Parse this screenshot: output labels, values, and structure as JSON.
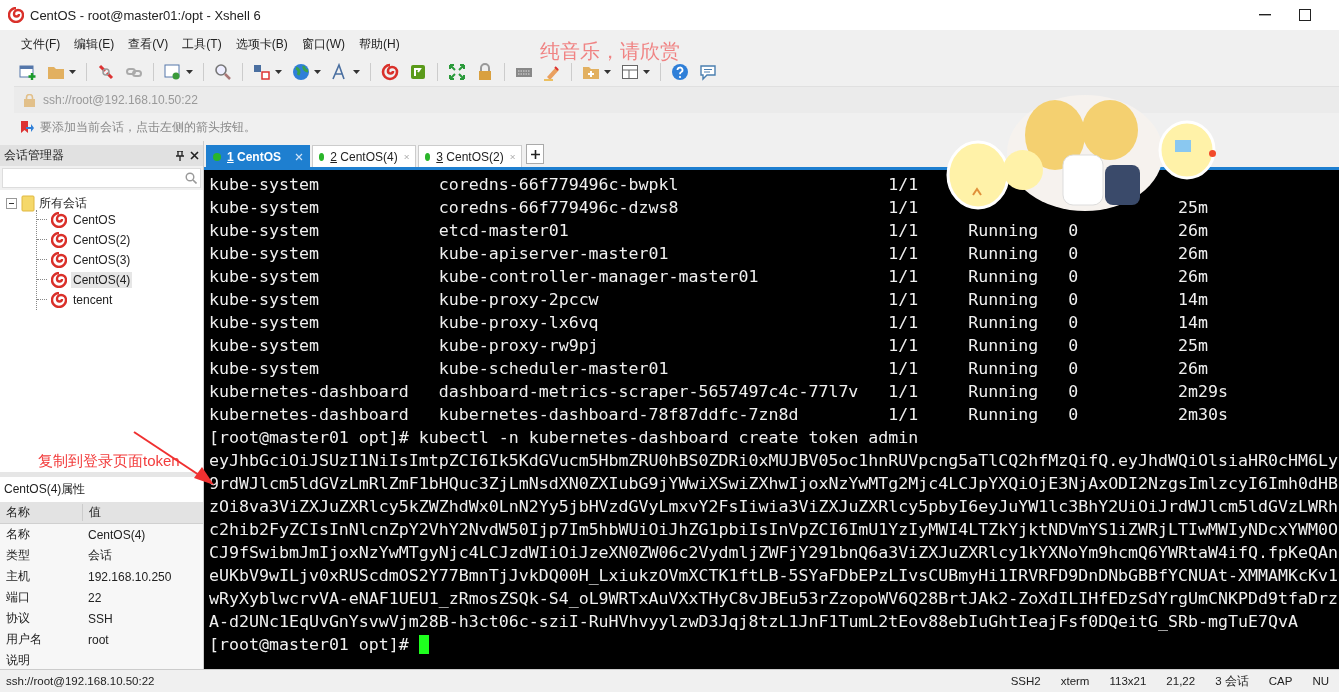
{
  "window": {
    "title": "CentOS - root@master01:/opt - Xshell 6"
  },
  "menu": [
    "文件(F)",
    "编辑(E)",
    "查看(V)",
    "工具(T)",
    "选项卡(B)",
    "窗口(W)",
    "帮助(H)"
  ],
  "overlay_text": "纯音乐，请欣赏",
  "address": {
    "value": "ssh://root@192.168.10.50:22"
  },
  "hint": "要添加当前会话，点击左侧的箭头按钮。",
  "session_manager": {
    "title": "会话管理器",
    "tree": [
      {
        "label": "所有会话",
        "expanded": true,
        "children": [
          {
            "label": "CentOS",
            "selected": false
          },
          {
            "label": "CentOS(2)",
            "selected": false
          },
          {
            "label": "CentOS(3)",
            "selected": false
          },
          {
            "label": "CentOS(4)",
            "selected": true
          },
          {
            "label": "tencent",
            "selected": false
          }
        ]
      }
    ]
  },
  "annotation": "复制到登录页面token",
  "properties": {
    "title": "CentOS(4)属性",
    "columns": [
      "名称",
      "值"
    ],
    "rows": [
      [
        "名称",
        "CentOS(4)"
      ],
      [
        "类型",
        "会话"
      ],
      [
        "主机",
        "192.168.10.250"
      ],
      [
        "端口",
        "22"
      ],
      [
        "协议",
        "SSH"
      ],
      [
        "用户名",
        "root"
      ],
      [
        "说明"
      ]
    ]
  },
  "tabs": [
    {
      "number": "1",
      "label": "CentOS",
      "selected": true
    },
    {
      "number": "2",
      "label": "CentOS(4)",
      "selected": false
    },
    {
      "number": "3",
      "label": "CentOS(2)",
      "selected": false
    }
  ],
  "terminal": {
    "pods": [
      {
        "namespace": "kube-system",
        "name": "coredns-66f779496c-bwpkl",
        "ready": "1/1"
      },
      {
        "namespace": "kube-system",
        "name": "coredns-66f779496c-dzws8",
        "ready": "1/1",
        "age": "25m"
      },
      {
        "namespace": "kube-system",
        "name": "etcd-master01",
        "ready": "1/1",
        "status": "Running",
        "restarts": "0",
        "age": "26m"
      },
      {
        "namespace": "kube-system",
        "name": "kube-apiserver-master01",
        "ready": "1/1",
        "status": "Running",
        "restarts": "0",
        "age": "26m"
      },
      {
        "namespace": "kube-system",
        "name": "kube-controller-manager-master01",
        "ready": "1/1",
        "status": "Running",
        "restarts": "0",
        "age": "26m"
      },
      {
        "namespace": "kube-system",
        "name": "kube-proxy-2pccw",
        "ready": "1/1",
        "status": "Running",
        "restarts": "0",
        "age": "14m"
      },
      {
        "namespace": "kube-system",
        "name": "kube-proxy-lx6vq",
        "ready": "1/1",
        "status": "Running",
        "restarts": "0",
        "age": "14m"
      },
      {
        "namespace": "kube-system",
        "name": "kube-proxy-rw9pj",
        "ready": "1/1",
        "status": "Running",
        "restarts": "0",
        "age": "25m"
      },
      {
        "namespace": "kube-system",
        "name": "kube-scheduler-master01",
        "ready": "1/1",
        "status": "Running",
        "restarts": "0",
        "age": "26m"
      },
      {
        "namespace": "kubernetes-dashboard",
        "name": "dashboard-metrics-scraper-5657497c4c-77l7v",
        "ready": "1/1",
        "status": "Running",
        "restarts": "0",
        "age": "2m29s"
      },
      {
        "namespace": "kubernetes-dashboard",
        "name": "kubernetes-dashboard-78f87ddfc-7zn8d",
        "ready": "1/1",
        "status": "Running",
        "restarts": "0",
        "age": "2m30s"
      }
    ],
    "command_line": "[root@master01 opt]# kubectl -n kubernetes-dashboard create token admin",
    "token_lines": [
      "eyJhbGciOiJSUzI1NiIsImtpZCI6Ik5KdGVucm5HbmZRU0hBS0ZDRi0xMUJBV05oc1hnRUVpcng5aTlCQ2hfMzQifQ.eyJhdWQiOlsiaHR0cHM6Ly",
      "9rdWJlcm5ldGVzLmRlZmF1bHQuc3ZjLmNsdXN0ZXIubG9jYWwiXSwiZXhwIjoxNzYwMTg2Mjc4LCJpYXQiOjE3NjAxODI2NzgsImlzcyI6Imh0dHB",
      "zOi8va3ViZXJuZXRlcy5kZWZhdWx0LnN2Yy5jbHVzdGVyLmxvY2FsIiwia3ViZXJuZXRlcy5pbyI6eyJuYW1lc3BhY2UiOiJrdWJlcm5ldGVzLWRh",
      "c2hib2FyZCIsInNlcnZpY2VhY2NvdW50Ijp7Im5hbWUiOiJhZG1pbiIsInVpZCI6ImU1YzIyMWI4LTZkYjktNDVmYS1iZWRjLTIwMWIyNDcxYWM0O",
      "CJ9fSwibmJmIjoxNzYwMTgyNjc4LCJzdWIiOiJzeXN0ZW06c2VydmljZWFjY291bnQ6a3ViZXJuZXRlcy1kYXNoYm9hcmQ6YWRtaW4ifQ.fpKeQAn",
      "eUKbV9wILjv0xRUScdmOS2Y77BmnTjJvkDQ00H_LxiukzOVmXCTK1ftLB-5SYaFDbEPzLIvsCUBmyHi1IRVRFD9DnDNbGBBfYCNUAt-XMMAMKcKv1",
      "wRyXyblwcrvVA-eNAF1UEU1_zRmosZSQk-S4_oL9WRTxAuVXxTHyC8vJBEu53rZzopoWV6Q28BrtJAk2-ZoXdILIHfEDzSdYrgUmCNKPDd9tfaDrz",
      "A-d2UNc1EqUvGnYsvwVjm28B-h3ct06c-sziI-RuHVhvyylzwD3Jqj8tzL1JnF1TumL2tEov88ebIuGhtIeajFsf0DQeitG_SRb-mgTuE7QvA"
    ],
    "prompt": "[root@master01 opt]#"
  },
  "status_bar": [
    "ssh://root@192.168.10.50:22",
    "SSH2",
    "xterm",
    "113x21",
    "21,22",
    "3 会话",
    "CAP",
    "NU"
  ]
}
